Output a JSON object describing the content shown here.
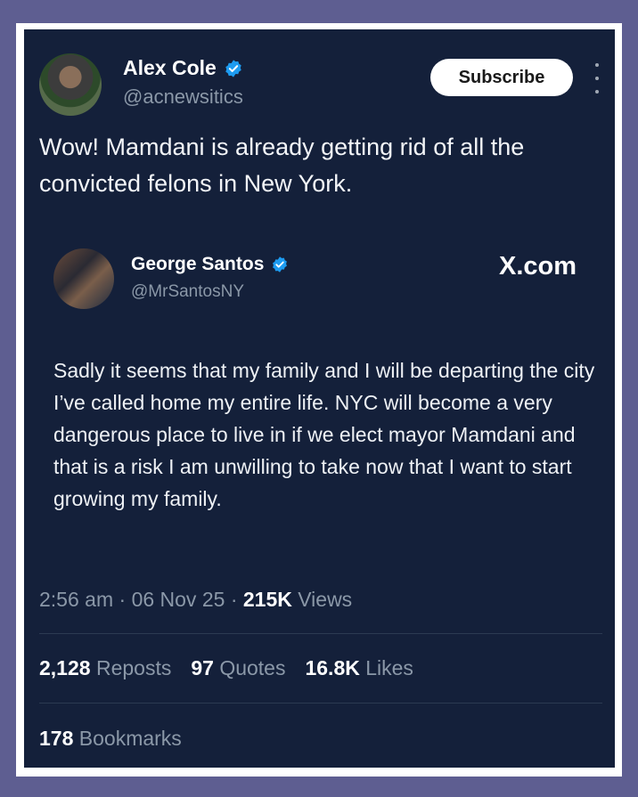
{
  "tweet": {
    "author_name": "Alex Cole",
    "author_handle": "@acnewsitics",
    "subscribe_label": "Subscribe",
    "text": "Wow! Mamdani is already getting rid of all the convicted felons in New York."
  },
  "quoted": {
    "author_name": "George Santos",
    "author_handle": "@MrSantosNY",
    "source": "X.com",
    "text": "Sadly it seems that my family and I will be departing the city I’ve called home my entire life. NYC will become a very dangerous place to live in if we elect mayor Mamdani and that is a risk I am unwilling to take now that I want to start growing my family."
  },
  "meta": {
    "time": "2:56 am",
    "date": "06 Nov 25",
    "views_count": "215K",
    "views_label": "Views"
  },
  "stats": {
    "reposts_count": "2,128",
    "reposts_label": "Reposts",
    "quotes_count": "97",
    "quotes_label": "Quotes",
    "likes_count": "16.8K",
    "likes_label": "Likes",
    "bookmarks_count": "178",
    "bookmarks_label": "Bookmarks"
  },
  "icons": {
    "verified": "verified-badge-icon",
    "more": "more-options-icon"
  },
  "colors": {
    "card_background": "#14203a",
    "verified_blue": "#1d9bf0",
    "secondary_text": "#8b98a8",
    "frame_border": "#5e5e91"
  }
}
